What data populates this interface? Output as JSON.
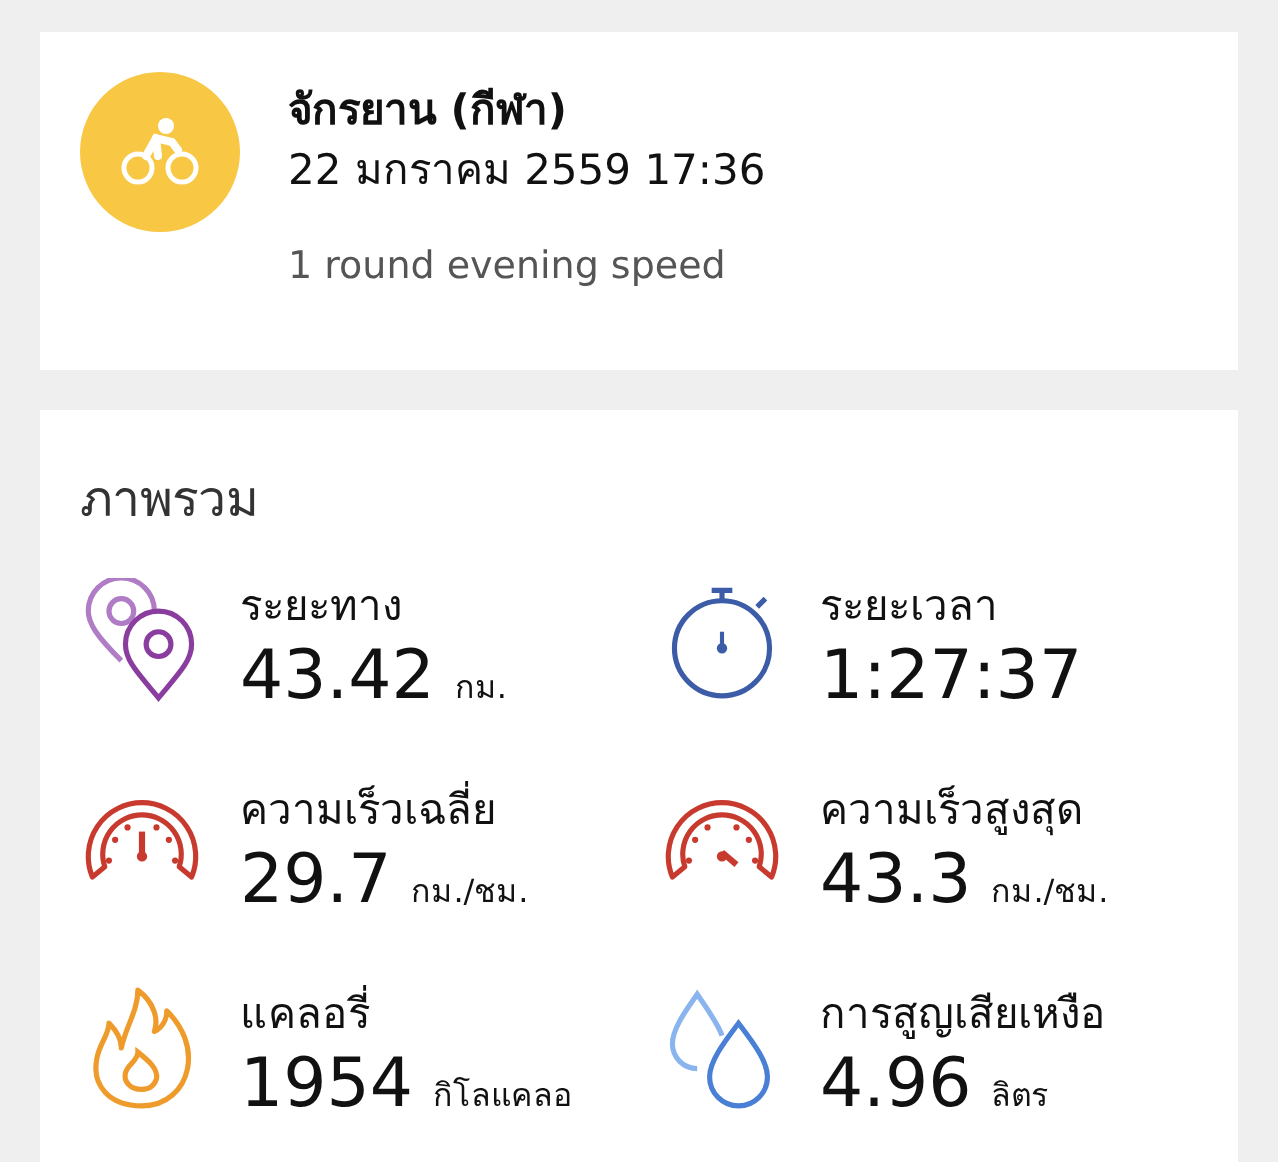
{
  "activity": {
    "title": "จักรยาน (กีฬา)",
    "datetime": "22 มกราคม 2559 17:36",
    "note": "1 round evening speed"
  },
  "overview": {
    "title": "ภาพรวม",
    "metrics": [
      {
        "kind": "distance",
        "label": "ระยะทาง",
        "value": "43.42",
        "unit": "กม."
      },
      {
        "kind": "duration",
        "label": "ระยะเวลา",
        "value": "1:27:37"
      },
      {
        "kind": "avg_speed",
        "label": "ความเร็วเฉลี่ย",
        "value": "29.7",
        "unit": "กม./ชม."
      },
      {
        "kind": "max_speed",
        "label": "ความเร็วสูงสุด",
        "value": "43.3",
        "unit": "กม./ชม."
      },
      {
        "kind": "calories",
        "label": "แคลอรี่",
        "value": "1954",
        "unit": "กิโลแคลอ"
      },
      {
        "kind": "sweat",
        "label": "การสูญเสียเหงือ",
        "value": "4.96",
        "unit": "ลิตร"
      }
    ]
  }
}
